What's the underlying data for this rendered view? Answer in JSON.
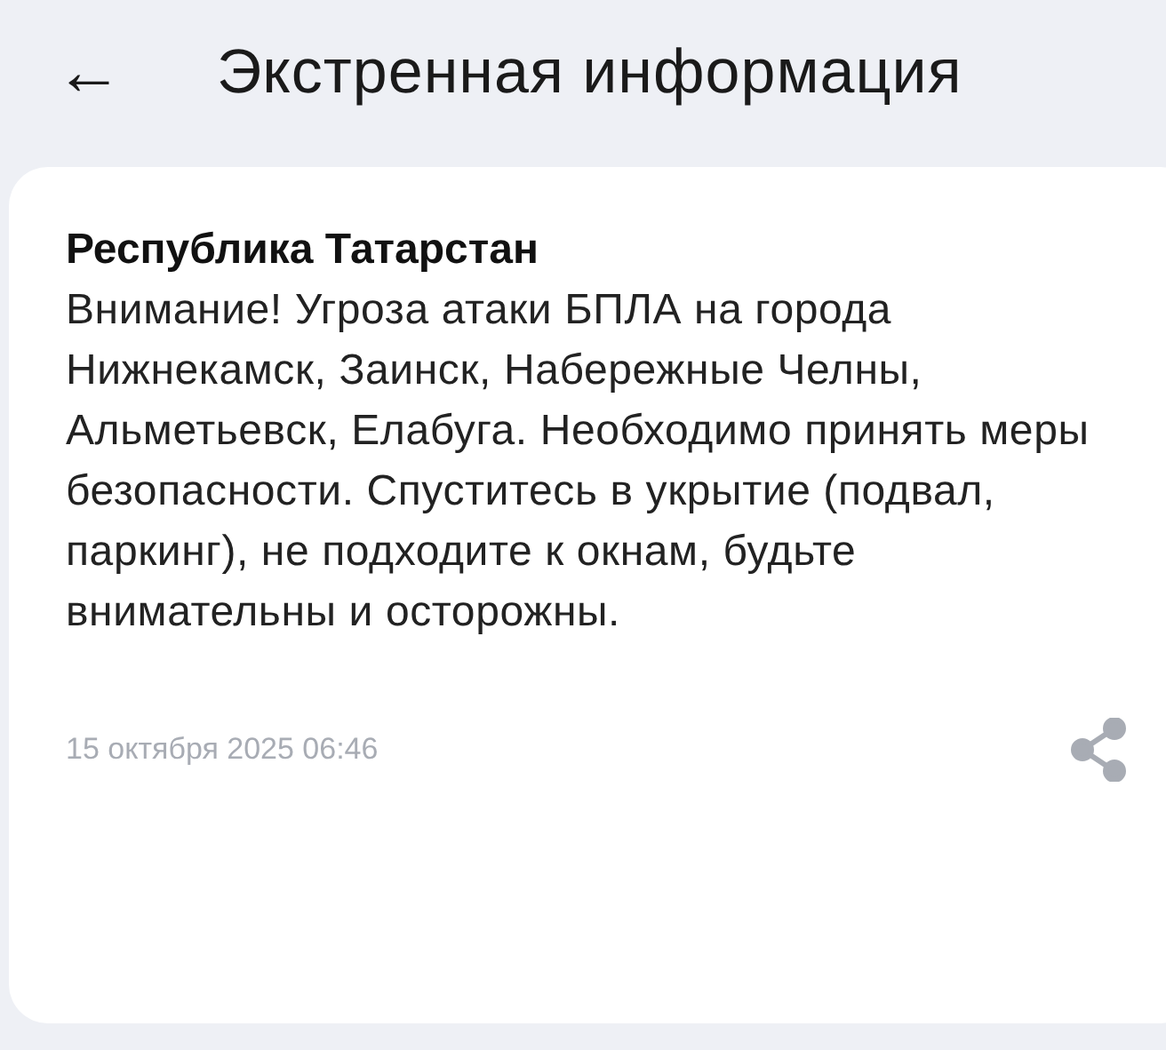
{
  "header": {
    "back": "←",
    "title": "Экстренная информация"
  },
  "alert": {
    "region": "Республика Татарстан",
    "message": "Внимание! Угроза атаки БПЛА на города Нижнекамск, Заинск, Набережные Челны, Альметьевск, Елабуга. Необходимо принять меры безопасности. Спуститесь в укрытие (подвал, паркинг), не подходите к окнам, будьте внимательны и осторожны.",
    "date": "15 октября 2025 06:46"
  }
}
